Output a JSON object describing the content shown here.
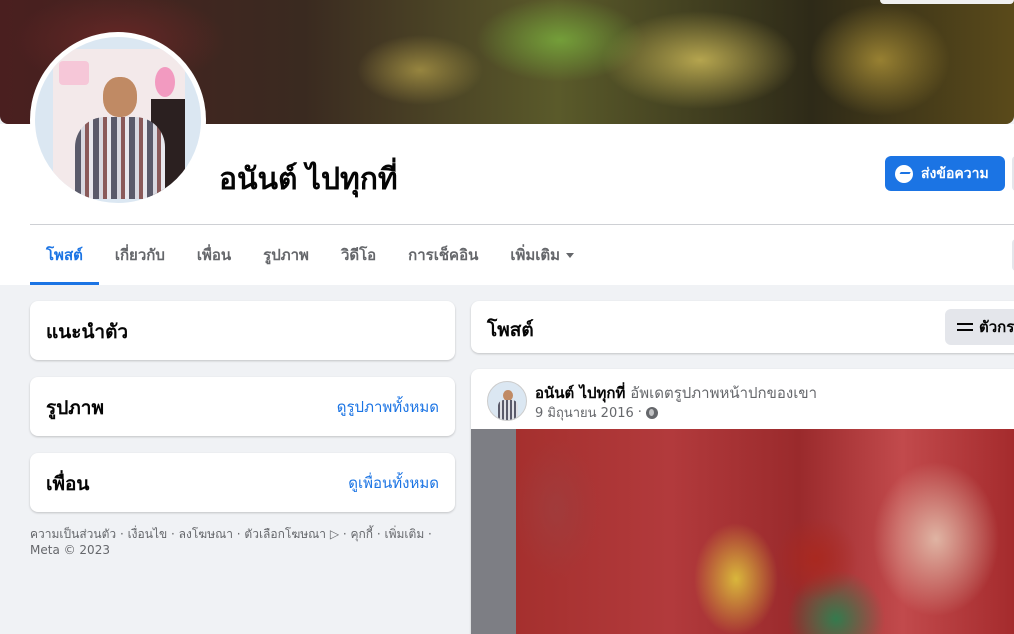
{
  "profile": {
    "name": "อนันต์ ไปทุกที่",
    "message_button": "ส่งข้อความ"
  },
  "tabs": [
    {
      "label": "โพสต์",
      "active": true
    },
    {
      "label": "เกี่ยวกับ"
    },
    {
      "label": "เพื่อน"
    },
    {
      "label": "รูปภาพ"
    },
    {
      "label": "วิดีโอ"
    },
    {
      "label": "การเช็คอิน"
    },
    {
      "label": "เพิ่มเติม",
      "dropdown": true
    }
  ],
  "sidebar": {
    "intro": {
      "title": "แนะนำตัว"
    },
    "photos": {
      "title": "รูปภาพ",
      "link": "ดูรูปภาพทั้งหมด"
    },
    "friends": {
      "title": "เพื่อน",
      "link": "ดูเพื่อนทั้งหมด"
    },
    "footer": "ความเป็นส่วนตัว · เงื่อนไข · ลงโฆษณา · ตัวเลือกโฆษณา ▷ · คุกกี้ · เพิ่มเติม · Meta © 2023"
  },
  "posts_header": {
    "title": "โพสต์",
    "filter_label": "ตัวกรอง"
  },
  "post": {
    "author": "อนันต์ ไปทุกที่",
    "action": "อัพเดตรูปภาพหน้าปกของเขา",
    "date": "9 มิถุนายน 2016",
    "privacy_icon": "globe-icon"
  },
  "colors": {
    "accent": "#1b74e4",
    "background": "#f0f2f5"
  }
}
